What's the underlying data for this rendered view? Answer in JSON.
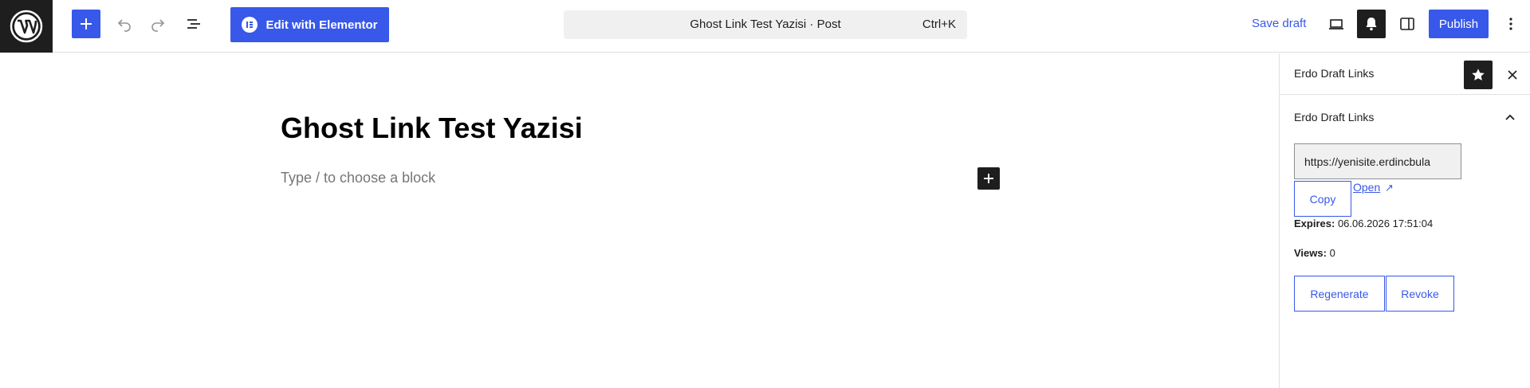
{
  "colors": {
    "accent": "#3858e9",
    "dark": "#1e1e1e",
    "border": "#e0e0e0",
    "placeholder": "#757575"
  },
  "toolbar": {
    "logo_icon": "wordpress-logo-icon",
    "add_icon": "plus-icon",
    "undo_icon": "undo-icon",
    "redo_icon": "redo-icon",
    "list_view_icon": "list-view-icon",
    "elementor_label": "Edit with Elementor",
    "command_title": "Ghost Link Test Yazisi · Post",
    "command_shortcut": "Ctrl+K",
    "save_draft_label": "Save draft",
    "preview_icon": "desktop-preview-icon",
    "bell_icon": "bell-icon",
    "sidebar_icon": "sidebar-toggle-icon",
    "publish_label": "Publish",
    "options_icon": "more-vertical-icon"
  },
  "editor": {
    "post_title": "Ghost Link Test Yazisi",
    "block_placeholder": "Type / to choose a block"
  },
  "sidebar": {
    "header_title": "Erdo Draft Links",
    "panel_title": "Erdo Draft Links",
    "url_value": "https://yenisite.erdincbula",
    "copy_label": "Copy",
    "open_label": "Open",
    "open_arrow": "↗",
    "expires_label": "Expires:",
    "expires_value": "06.06.2026 17:51:04",
    "views_label": "Views:",
    "views_value": "0",
    "regenerate_label": "Regenerate",
    "revoke_label": "Revoke"
  }
}
